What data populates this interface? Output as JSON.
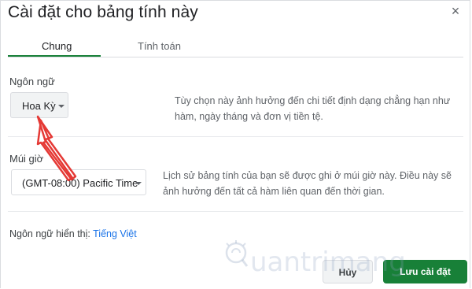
{
  "dialog": {
    "title": "Cài đặt cho bảng tính này",
    "close_glyph": "×"
  },
  "tabs": [
    {
      "label": "Chung",
      "active": true
    },
    {
      "label": "Tính toán",
      "active": false
    }
  ],
  "locale": {
    "label": "Ngôn ngữ",
    "selected": "Hoa Kỳ",
    "description": "Tùy chọn này ảnh hưởng đến chi tiết định dạng chẳng hạn như hàm, ngày tháng và đơn vị tiền tệ."
  },
  "timezone": {
    "label": "Múi giờ",
    "selected": "(GMT-08:00) Pacific Time",
    "description": "Lịch sử bảng tính của bạn sẽ được ghi ở múi giờ này. Điều này sẽ ảnh hưởng đến tất cả hàm liên quan đến thời gian."
  },
  "display_language": {
    "label": "Ngôn ngữ hiển thị:",
    "value": "Tiếng Việt"
  },
  "buttons": {
    "cancel": "Hủy",
    "save": "Lưu cài đặt"
  },
  "watermark": {
    "text": "uantrimang"
  },
  "colors": {
    "accent_green": "#188038",
    "link_blue": "#1a73e8",
    "annotation_red": "#e53935"
  }
}
